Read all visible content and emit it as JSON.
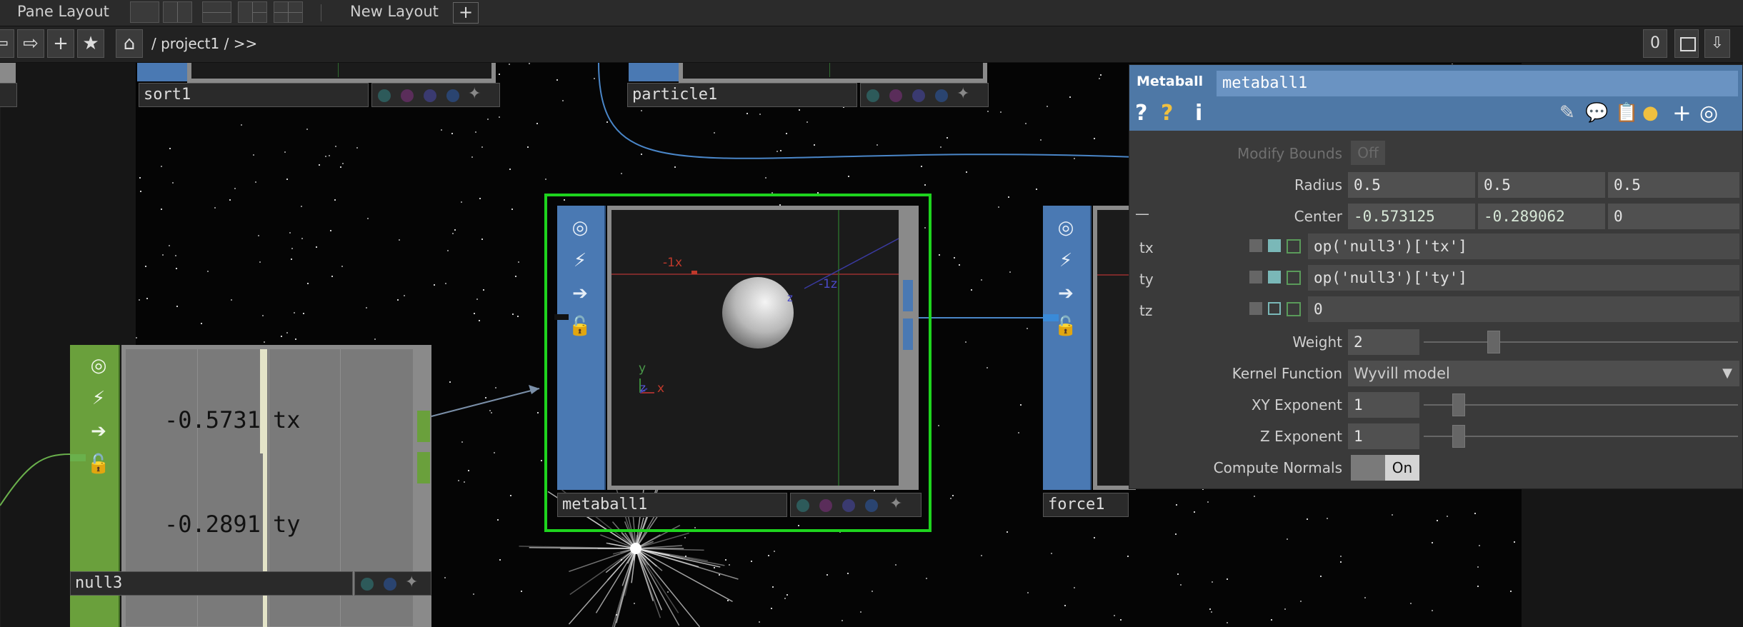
{
  "toolbar": {
    "pane_layout_label": "Pane Layout",
    "new_layout_label": "New Layout",
    "add_layout_icon": "+"
  },
  "pathbar": {
    "path": "/ project1 / >>",
    "counter": "0",
    "icons": {
      "back": "⇦",
      "forward": "⇨",
      "add": "+",
      "star": "★",
      "home": "⌂"
    }
  },
  "nodes": {
    "sort1": {
      "label": "sort1"
    },
    "particle1": {
      "label": "particle1"
    },
    "metaball1": {
      "label": "metaball1",
      "axis_x": "-1x",
      "axis_z": "-1z",
      "axis_z2": "z",
      "corner_y": "y",
      "corner_x": "x",
      "corner_z": "z"
    },
    "force1": {
      "label": "force1"
    },
    "null3": {
      "label": "null3",
      "tx_value": "-0.5731",
      "tx_name": "tx",
      "ty_value": "-0.2891",
      "ty_name": "ty"
    }
  },
  "panel": {
    "op_type": "Metaball",
    "op_name": "metaball1",
    "help_icons": {
      "help": "?",
      "python_help": "?",
      "info": "i"
    },
    "modify_bounds": {
      "label": "Modify Bounds",
      "value": "Off"
    },
    "radius": {
      "label": "Radius",
      "values": [
        "0.5",
        "0.5",
        "0.5"
      ]
    },
    "center": {
      "label": "Center",
      "values": [
        "-0.573125",
        "-0.289062",
        "0"
      ],
      "dash": "—"
    },
    "tx": {
      "label": "tx",
      "expr": "op('null3')['tx']"
    },
    "ty": {
      "label": "ty",
      "expr": "op('null3')['ty']"
    },
    "tz": {
      "label": "tz",
      "expr": "0"
    },
    "weight": {
      "label": "Weight",
      "value": "2",
      "slider_fraction": 0.22
    },
    "kernel": {
      "label": "Kernel Function",
      "value": "Wyvill model"
    },
    "xy_exp": {
      "label": "XY Exponent",
      "value": "1",
      "slider_fraction": 0.11
    },
    "z_exp": {
      "label": "Z Exponent",
      "value": "1",
      "slider_fraction": 0.11
    },
    "normals": {
      "label": "Compute Normals",
      "value": "On"
    }
  }
}
